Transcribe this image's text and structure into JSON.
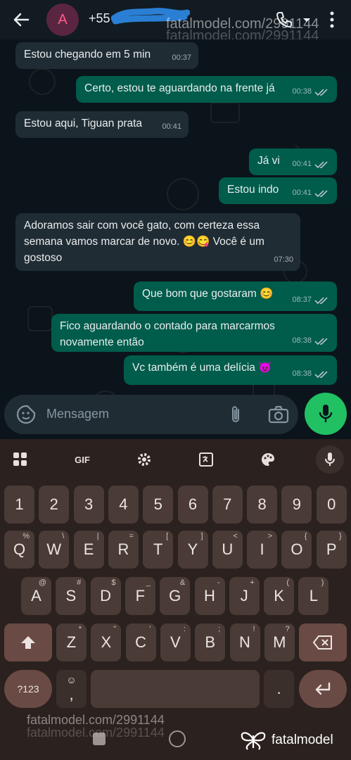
{
  "header": {
    "avatar_letter": "A",
    "contact_name": "+55",
    "watermark": "fatalmodel.com/2991144"
  },
  "messages": [
    {
      "direction": "in",
      "text": "Estou chegando em 5 min",
      "time": "00:37"
    },
    {
      "direction": "out",
      "text": "Certo, estou te aguardando na frente já",
      "time": "00:38"
    },
    {
      "direction": "in",
      "text": "Estou aqui, Tiguan prata",
      "time": "00:41"
    },
    {
      "direction": "out",
      "text": "Já vi",
      "time": "00:41"
    },
    {
      "direction": "out",
      "text": "Estou indo",
      "time": "00:41"
    },
    {
      "direction": "in",
      "text": "Adoramos sair com você gato, com certeza essa semana vamos marcar de novo. 😊😋 Você é um gostoso",
      "time": "07:30"
    },
    {
      "direction": "out",
      "text": "Que bom que gostaram 😊",
      "time": "08:37"
    },
    {
      "direction": "out",
      "text": "Fico aguardando o contado para marcarmos novamente então",
      "time": "08:38"
    },
    {
      "direction": "out",
      "text": "Vc também é uma delícia 😈",
      "time": "08:38"
    }
  ],
  "composer": {
    "placeholder": "Mensagem"
  },
  "keyboard": {
    "toolbar": {
      "gif_label": "GIF"
    },
    "number_row": [
      "1",
      "2",
      "3",
      "4",
      "5",
      "6",
      "7",
      "8",
      "9",
      "0"
    ],
    "row1": [
      {
        "key": "Q",
        "hint": "%"
      },
      {
        "key": "W",
        "hint": "\\"
      },
      {
        "key": "E",
        "hint": "|"
      },
      {
        "key": "R",
        "hint": "="
      },
      {
        "key": "T",
        "hint": "["
      },
      {
        "key": "Y",
        "hint": "]"
      },
      {
        "key": "U",
        "hint": "<"
      },
      {
        "key": "I",
        "hint": ">"
      },
      {
        "key": "O",
        "hint": "{"
      },
      {
        "key": "P",
        "hint": "}"
      }
    ],
    "row2": [
      {
        "key": "A",
        "hint": "@"
      },
      {
        "key": "S",
        "hint": "#"
      },
      {
        "key": "D",
        "hint": "$"
      },
      {
        "key": "F",
        "hint": "_"
      },
      {
        "key": "G",
        "hint": "&"
      },
      {
        "key": "H",
        "hint": "-"
      },
      {
        "key": "J",
        "hint": "+"
      },
      {
        "key": "K",
        "hint": "("
      },
      {
        "key": "L",
        "hint": ")"
      }
    ],
    "row3": [
      {
        "key": "Z",
        "hint": "*"
      },
      {
        "key": "X",
        "hint": "\""
      },
      {
        "key": "C",
        "hint": "'"
      },
      {
        "key": "V",
        "hint": ":"
      },
      {
        "key": "B",
        "hint": ";"
      },
      {
        "key": "N",
        "hint": "!"
      },
      {
        "key": "M",
        "hint": "?"
      }
    ],
    "symbols_label": "?123",
    "comma_label": ",",
    "period_label": "."
  },
  "footer": {
    "watermark": "fatalmodel.com/2991144",
    "brand": "fatalmodel"
  },
  "colors": {
    "incoming": "#202c33",
    "outgoing": "#005c4b",
    "mic": "#21c063",
    "keyboard": "#2b211e"
  }
}
